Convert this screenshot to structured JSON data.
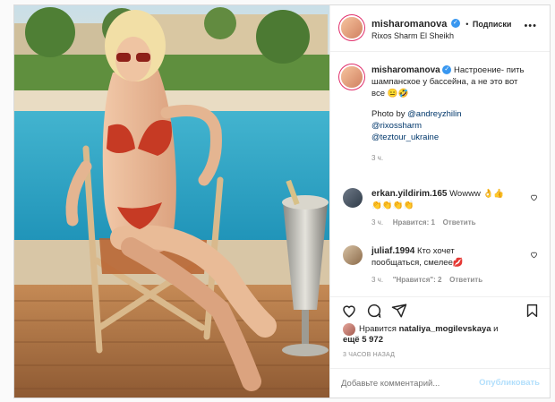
{
  "post": {
    "username": "misharomanova",
    "follow_label": "Подписки",
    "location": "Rixos Sharm El Sheikh"
  },
  "caption": {
    "username": "misharomanova",
    "text_line1": "Настроение- пить",
    "text_line2": "шампанское у бассейна, а не это вот",
    "text_line3": "все 😑🤣",
    "photo_by": "Photo by ",
    "mention1": "@andreyzhilin",
    "mention2": "@rixossharm",
    "mention3": "@teztour_ukraine",
    "time": "3 ч."
  },
  "comments": [
    {
      "username": "erkan.yildirim.165",
      "text_line1": "Wowww 👌👍",
      "text_line2": "👏👏👏👏",
      "time": "3 ч.",
      "likes": "Нравится: 1",
      "reply": "Ответить"
    },
    {
      "username": "juliaf.1994",
      "text_line1": "Кто хочет",
      "text_line2": "пообщаться, смелее💋",
      "time": "3 ч.",
      "likes": "\"Нравится\": 2",
      "reply": "Ответить"
    }
  ],
  "likes": {
    "prefix": "Нравится ",
    "user": "nataliya_mogilevskaya",
    "suffix": " и",
    "line2": "ещё 5 972"
  },
  "timestamp": "3 ЧАСОВ НАЗАД",
  "add_comment": {
    "placeholder": "Добавьте комментарий...",
    "publish_label": "Опубликовать"
  },
  "icons": [
    "more-icon",
    "heart-icon",
    "comment-icon",
    "share-icon",
    "bookmark-icon"
  ],
  "colors": {
    "accent": "#0095f6",
    "link": "#00376b",
    "muted": "#8e8e8e",
    "verified": "#3897f0"
  }
}
